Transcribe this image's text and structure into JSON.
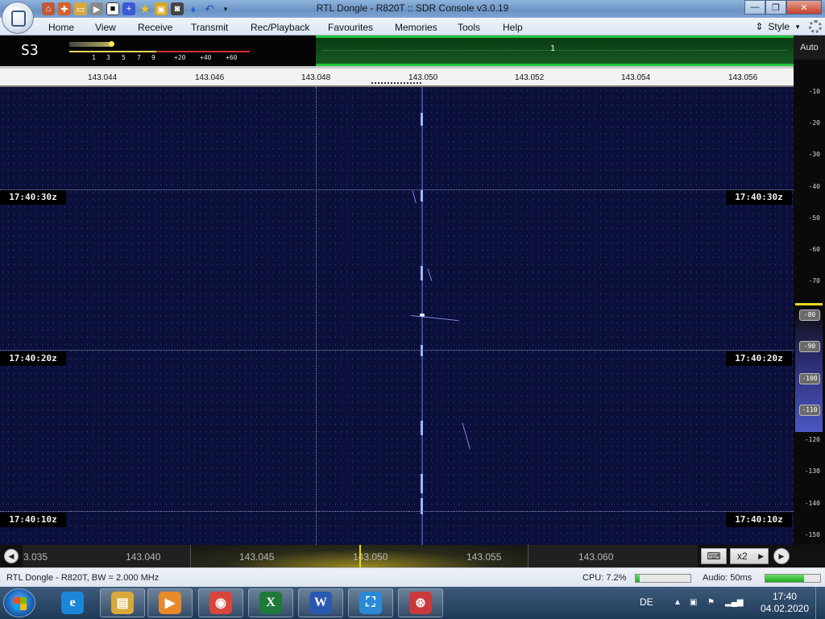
{
  "window": {
    "title": "RTL Dongle - R820T :: SDR Console v3.0.19",
    "buttons": {
      "minimize": "—",
      "maximize": "❐",
      "close": "✕"
    }
  },
  "quick_access": [
    "home-icon",
    "lifebuoy-icon",
    "folder-icon",
    "play-icon",
    "stop-icon",
    "add-icon",
    "star-icon",
    "lock-icon",
    "camera-icon",
    "drop-icon",
    "undo-icon",
    "dropdown-icon"
  ],
  "menu": {
    "items": [
      "Home",
      "View",
      "Receive",
      "Transmit",
      "Rec/Playback",
      "Favourites",
      "Memories",
      "Tools",
      "Help"
    ],
    "style_label": "Style"
  },
  "meter": {
    "reading": "S3",
    "scale_ticks": [
      "1",
      "3",
      "5",
      "7",
      "9",
      "+20",
      "+40",
      "+60"
    ],
    "level_pct": 24
  },
  "spectrum": {
    "marker": "1"
  },
  "ruler": {
    "labels": [
      "143.044",
      "143.046",
      "143.048",
      "143.050",
      "143.052",
      "143.054",
      "143.056"
    ]
  },
  "waterfall": {
    "time_labels": [
      "17:40:30z",
      "17:40:20z",
      "17:40:10z"
    ]
  },
  "db_scale": {
    "auto_label": "Auto",
    "labels": [
      "-10",
      "-20",
      "-30",
      "-40",
      "-50",
      "-60",
      "-70",
      "-80",
      "-90",
      "-100",
      "-110",
      "-120",
      "-130",
      "-140",
      "-150"
    ],
    "highlighted": [
      "-80",
      "-90",
      "-100",
      "-110"
    ],
    "colors": {
      "range_top": "#e8d820",
      "range_fill": "#4a58c4"
    }
  },
  "freq_bar": {
    "labels": [
      "3.035",
      "143.040",
      "143.045",
      "143.050",
      "143.055",
      "143.060"
    ],
    "zoom": "x2",
    "cursor_color": "#e8d820"
  },
  "status": {
    "device": "RTL Dongle - R820T, BW = 2.000 MHz",
    "cpu_label": "CPU: 7.2%",
    "cpu_pct": 7.2,
    "audio_label": "Audio: 50ms",
    "audio_pct": 70
  },
  "taskbar": {
    "apps": [
      {
        "name": "internet-explorer",
        "glyph": "e",
        "color": "#1c86d8"
      },
      {
        "name": "file-explorer",
        "glyph": "▤",
        "color": "#d8a83a"
      },
      {
        "name": "media-player",
        "glyph": "▶",
        "color": "#e8892a"
      },
      {
        "name": "chrome",
        "glyph": "◉",
        "color": "#d8453a"
      },
      {
        "name": "excel",
        "glyph": "X",
        "color": "#1f7a3a"
      },
      {
        "name": "word",
        "glyph": "W",
        "color": "#2a5ab0"
      },
      {
        "name": "snipping-tool",
        "glyph": "⛶",
        "color": "#2a8ad8"
      },
      {
        "name": "sdr-console",
        "glyph": "⊛",
        "color": "#c83a3a"
      }
    ],
    "language": "DE",
    "time": "17:40",
    "date": "04.02.2020"
  }
}
